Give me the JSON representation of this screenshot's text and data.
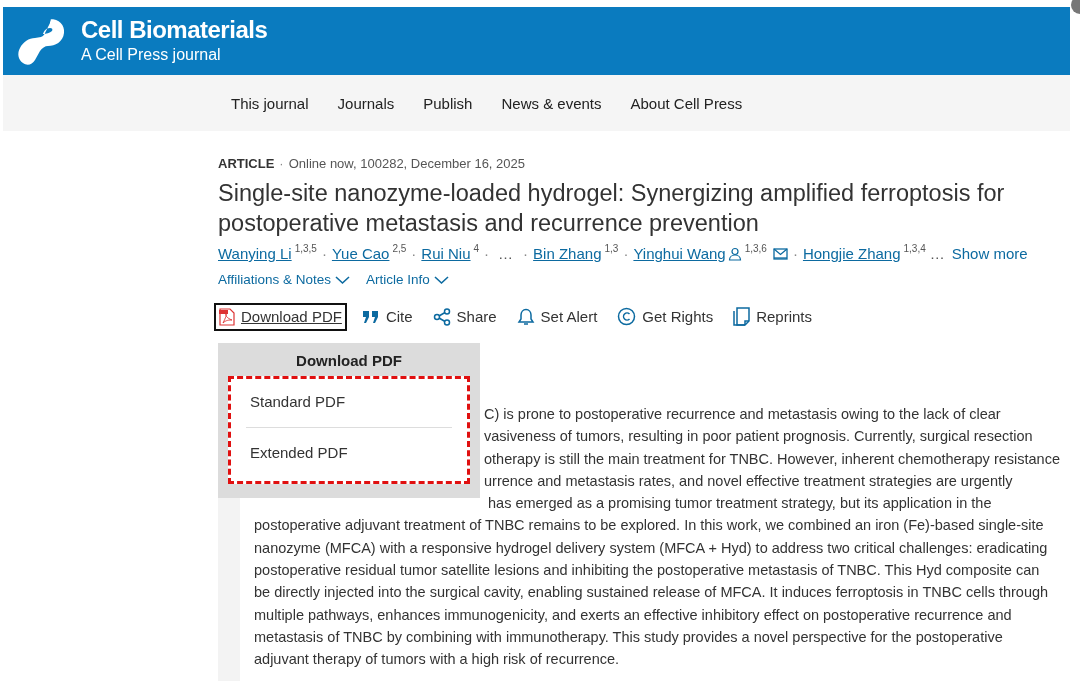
{
  "header": {
    "title": "Cell Biomaterials",
    "subtitle": "A Cell Press journal"
  },
  "nav": [
    "This journal",
    "Journals",
    "Publish",
    "News & events",
    "About Cell Press"
  ],
  "article": {
    "type": "ARTICLE",
    "meta_separator": "·",
    "meta": "Online now, 100282, December 16, 2025",
    "title": "Single-site nanozyme-loaded hydrogel: Synergizing amplified ferroptosis for postoperative metastasis and recurrence prevention",
    "authors": [
      {
        "kind": "author",
        "name": "Wanying Li",
        "sup": "1,3,5",
        "corresponding": false,
        "email": false
      },
      {
        "kind": "author",
        "sep": "·",
        "name": "Yue Cao",
        "sup": "2,5",
        "corresponding": false,
        "email": false
      },
      {
        "kind": "author",
        "sep": "·",
        "name": "Rui Niu",
        "sup": "4",
        "corresponding": false,
        "email": false
      },
      {
        "kind": "ellipsis",
        "sep": "·",
        "name": "…"
      },
      {
        "kind": "author",
        "sep": "·",
        "name": "Bin Zhang",
        "sup": "1,3",
        "corresponding": false,
        "email": false
      },
      {
        "kind": "author",
        "sep": "·",
        "name": "Yinghui Wang",
        "sup": "1,3,6",
        "corresponding": true,
        "email": true
      },
      {
        "kind": "author",
        "sep": "·",
        "name": "Hongjie Zhang",
        "sup": "1,3,4",
        "corresponding": false,
        "email": false
      }
    ],
    "authors_more": "…",
    "show_more": "Show more",
    "info_links": [
      "Affiliations & Notes",
      "Article Info"
    ]
  },
  "actions": [
    {
      "kind": "pdf",
      "label": "Download PDF",
      "selected": true
    },
    {
      "kind": "cite",
      "label": "Cite",
      "selected": false
    },
    {
      "kind": "share",
      "label": "Share",
      "selected": false
    },
    {
      "kind": "alert",
      "label": "Set Alert",
      "selected": false
    },
    {
      "kind": "rights",
      "label": "Get Rights",
      "selected": false
    },
    {
      "kind": "reprints",
      "label": "Reprints",
      "selected": false
    }
  ],
  "menu": {
    "title": "Download PDF",
    "highlighted": true,
    "items": [
      "Standard PDF",
      "Extended PDF"
    ]
  },
  "abstract": [
    {
      "kind": "partial",
      "text": "C) is prone to postoperative recurrence and metastasis owing to the lack of clear"
    },
    {
      "kind": "partial",
      "text": "vasiveness of tumors, resulting in poor patient prognosis. Currently, surgical resection"
    },
    {
      "kind": "partial",
      "text": "otherapy is still the main treatment for TNBC. However, inherent chemotherapy resistance"
    },
    {
      "kind": "partial",
      "text": "urrence and metastasis rates, and novel effective treatment strategies are urgently"
    },
    {
      "kind": "partial_low",
      "text": "has emerged as a promising tumor treatment strategy, but its application in the"
    },
    {
      "kind": "full",
      "text": "postoperative adjuvant treatment of TNBC remains to be explored. In this work, we combined an iron (Fe)-based single-site"
    },
    {
      "kind": "full",
      "text": "nanozyme (MFCA) with a responsive hydrogel delivery system (MFCA + Hyd) to address two critical challenges: eradicating"
    },
    {
      "kind": "full",
      "text": "postoperative residual tumor satellite lesions and inhibiting the postoperative metastasis of TNBC. This Hyd composite can"
    },
    {
      "kind": "full",
      "text": "be directly injected into the surgical cavity, enabling sustained release of MFCA. It induces ferroptosis in TNBC cells through"
    },
    {
      "kind": "full",
      "text": "multiple pathways, enhances immunogenicity, and exerts an effective inhibitory effect on postoperative recurrence and"
    },
    {
      "kind": "full",
      "text": "metastasis of TNBC by combining with immunotherapy. This study provides a novel perspective for the postoperative"
    },
    {
      "kind": "full",
      "text": "adjuvant therapy of tumors with a high risk of recurrence."
    }
  ]
}
